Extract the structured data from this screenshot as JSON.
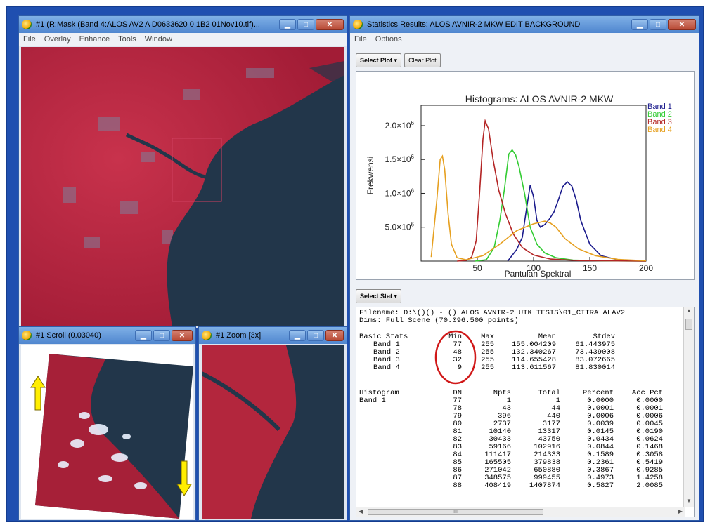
{
  "mask_window": {
    "title": "#1 (R:Mask (Band 4:ALOS AV2 A D0633620 0 1B2 01Nov10.tif)...",
    "menu": [
      "File",
      "Overlay",
      "Enhance",
      "Tools",
      "Window"
    ]
  },
  "scroll_window": {
    "title": "#1 Scroll (0.03040)"
  },
  "zoom_window": {
    "title": "#1 Zoom [3x]"
  },
  "stats_window": {
    "title": "Statistics Results: ALOS AVNIR-2 MKW EDIT BACKGROUND",
    "menu": [
      "File",
      "Options"
    ],
    "select_plot_label": "Select Plot",
    "clear_plot_label": "Clear Plot",
    "select_stat_label": "Select Stat"
  },
  "chart_data": {
    "type": "line",
    "title": "Histograms: ALOS AVNIR-2 MKW",
    "xlabel": "Pantulan Spektral",
    "ylabel": "Frekwensi",
    "xlim": [
      0,
      200
    ],
    "ylim": [
      0,
      2300000
    ],
    "xticks": [
      "50",
      "100",
      "150",
      "200"
    ],
    "yticks": [
      {
        "mant": "5.0",
        "value": 500000
      },
      {
        "mant": "1.0",
        "value": 1000000
      },
      {
        "mant": "1.5",
        "value": 1500000
      },
      {
        "mant": "2.0",
        "value": 2000000
      }
    ],
    "ytick_suffix": "×10",
    "ytick_exp": "6",
    "legend_position": "top-right",
    "series": [
      {
        "name": "Band 1",
        "color": "#1a1a8c",
        "x": [
          77,
          85,
          90,
          94,
          97,
          100,
          103,
          106,
          110,
          114,
          118,
          122,
          126,
          130,
          134,
          138,
          142,
          150,
          160,
          175,
          200
        ],
        "y": [
          0,
          170000,
          350000,
          800000,
          1120000,
          950000,
          600000,
          500000,
          540000,
          620000,
          720000,
          900000,
          1100000,
          1170000,
          1110000,
          900000,
          600000,
          250000,
          80000,
          20000,
          0
        ]
      },
      {
        "name": "Band 2",
        "color": "#33cc33",
        "x": [
          48,
          58,
          65,
          70,
          74,
          78,
          81,
          84,
          87,
          92,
          97,
          103,
          110,
          120,
          135,
          160,
          200
        ],
        "y": [
          0,
          20000,
          200000,
          600000,
          1050000,
          1580000,
          1640000,
          1570000,
          1400000,
          1000000,
          500000,
          250000,
          120000,
          50000,
          15000,
          5000,
          0
        ]
      },
      {
        "name": "Band 3",
        "color": "#b32424",
        "x": [
          32,
          40,
          45,
          49,
          52,
          55,
          57,
          60,
          64,
          69,
          75,
          82,
          90,
          100,
          115,
          140,
          200
        ],
        "y": [
          0,
          10000,
          60000,
          300000,
          1000000,
          1800000,
          2070000,
          1950000,
          1500000,
          1050000,
          700000,
          400000,
          200000,
          90000,
          30000,
          8000,
          0
        ]
      },
      {
        "name": "Band 4",
        "color": "#e6a020",
        "x": [
          9,
          14,
          17,
          19,
          21,
          24,
          27,
          32,
          40,
          55,
          70,
          85,
          100,
          110,
          115,
          120,
          128,
          140,
          155,
          175,
          200
        ],
        "y": [
          60000,
          900000,
          1500000,
          1550000,
          1350000,
          700000,
          250000,
          50000,
          20000,
          80000,
          250000,
          450000,
          550000,
          590000,
          560000,
          500000,
          330000,
          180000,
          80000,
          25000,
          5000
        ]
      }
    ]
  },
  "stats_text": {
    "filename_line": "Filename: D:\\()() - () ALOS AVNIR-2 UTK TESIS\\01_CITRA ALAV2",
    "dims_line": "Dims: Full Scene (70.096.500 points)",
    "basic_label": "Basic Stats",
    "basic_headers": {
      "min": "Min",
      "max": "Max",
      "mean": "Mean",
      "stdev": "Stdev"
    },
    "basic_rows": [
      {
        "band": "Band 1",
        "min": "77",
        "max": "255",
        "mean": "155.004209",
        "stdev": "61.443975"
      },
      {
        "band": "Band 2",
        "min": "48",
        "max": "255",
        "mean": "132.340267",
        "stdev": "73.439008"
      },
      {
        "band": "Band 3",
        "min": "32",
        "max": "255",
        "mean": "114.655428",
        "stdev": "83.072665"
      },
      {
        "band": "Band 4",
        "min": "9",
        "max": "255",
        "mean": "113.611567",
        "stdev": "81.830014"
      }
    ],
    "hist_label": "Histogram",
    "hist_band": "Band 1",
    "hist_headers": {
      "dn": "DN",
      "npts": "Npts",
      "total": "Total",
      "percent": "Percent",
      "acc": "Acc Pct"
    },
    "hist_rows": [
      [
        "77",
        "1",
        "1",
        "0.0000",
        "0.0000"
      ],
      [
        "78",
        "43",
        "44",
        "0.0001",
        "0.0001"
      ],
      [
        "79",
        "396",
        "440",
        "0.0006",
        "0.0006"
      ],
      [
        "80",
        "2737",
        "3177",
        "0.0039",
        "0.0045"
      ],
      [
        "81",
        "10140",
        "13317",
        "0.0145",
        "0.0190"
      ],
      [
        "82",
        "30433",
        "43750",
        "0.0434",
        "0.0624"
      ],
      [
        "83",
        "59166",
        "102916",
        "0.0844",
        "0.1468"
      ],
      [
        "84",
        "111417",
        "214333",
        "0.1589",
        "0.3058"
      ],
      [
        "85",
        "165505",
        "379838",
        "0.2361",
        "0.5419"
      ],
      [
        "86",
        "271042",
        "650880",
        "0.3867",
        "0.9285"
      ],
      [
        "87",
        "348575",
        "999455",
        "0.4973",
        "1.4258"
      ],
      [
        "88",
        "408419",
        "1407874",
        "0.5827",
        "2.0085"
      ]
    ],
    "hscroll_thumb": "III"
  },
  "colors": {
    "frame": "#1f4fb0",
    "land": "#b3263d",
    "sea": "#22364a",
    "highlight_circle": "#d01818",
    "arrow": "#ffee00"
  }
}
